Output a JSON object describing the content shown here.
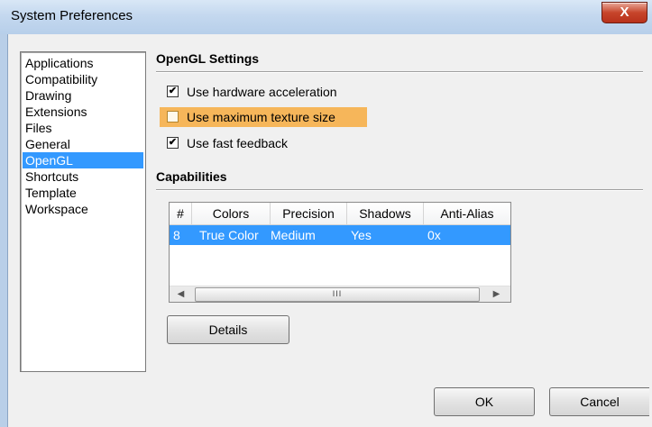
{
  "window": {
    "title": "System Preferences",
    "close_label": "X"
  },
  "sidebar": {
    "items": [
      {
        "label": "Applications"
      },
      {
        "label": "Compatibility"
      },
      {
        "label": "Drawing"
      },
      {
        "label": "Extensions"
      },
      {
        "label": "Files"
      },
      {
        "label": "General"
      },
      {
        "label": "OpenGL",
        "selected": true
      },
      {
        "label": "Shortcuts"
      },
      {
        "label": "Template"
      },
      {
        "label": "Workspace"
      }
    ]
  },
  "opengl": {
    "title": "OpenGL Settings",
    "options": [
      {
        "label": "Use hardware acceleration",
        "checked": true
      },
      {
        "label": "Use maximum texture size",
        "checked": false,
        "highlighted": true
      },
      {
        "label": "Use fast feedback",
        "checked": true
      }
    ]
  },
  "capabilities": {
    "title": "Capabilities",
    "columns": [
      "#",
      "Colors",
      "Precision",
      "Shadows",
      "Anti-Alias"
    ],
    "rows": [
      [
        "8",
        "True Color",
        "Medium",
        "Yes",
        "0x"
      ]
    ],
    "scroll_thumb": "III"
  },
  "buttons": {
    "details": "Details",
    "ok": "OK",
    "cancel": "Cancel"
  },
  "colors": {
    "selection": "#3399ff",
    "highlight": "#f6b65a"
  }
}
